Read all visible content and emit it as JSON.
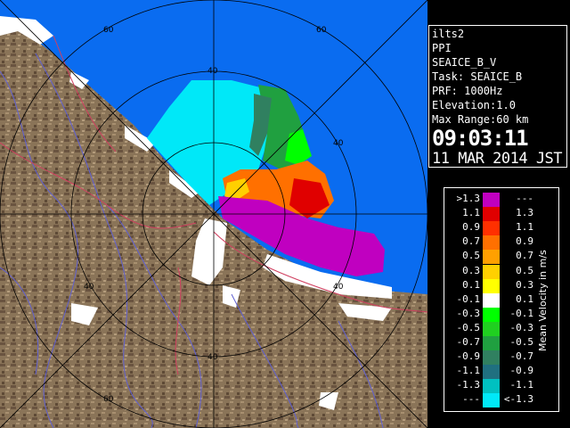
{
  "info": {
    "lines": [
      "ilts2",
      "PPI",
      "SEAICE_B_V",
      "Task: SEAICE_B",
      "PRF: 1000Hz",
      "Elevation:1.0",
      "Max Range:60 km"
    ],
    "time": "09:03:11",
    "date": "11 MAR 2014 JST"
  },
  "legend": {
    "units": "Mean Velocity in m/s",
    "rows": [
      {
        "left": ">1.3",
        "right": "---",
        "color": "#c000c0"
      },
      {
        "left": "1.1",
        "right": "1.3",
        "color": "#e00000"
      },
      {
        "left": "0.9",
        "right": "1.1",
        "color": "#ff3000"
      },
      {
        "left": "0.7",
        "right": "0.9",
        "color": "#ff7000"
      },
      {
        "left": "0.5",
        "right": "0.7",
        "color": "#ffa000"
      },
      {
        "left": "0.3",
        "right": "0.5",
        "color": "#ffd000"
      },
      {
        "left": "0.1",
        "right": "0.3",
        "color": "#ffff00"
      },
      {
        "left": "-0.1",
        "right": "0.1",
        "color": "#ffffff"
      },
      {
        "left": "-0.3",
        "right": "-0.1",
        "color": "#00ff00"
      },
      {
        "left": "-0.5",
        "right": "-0.3",
        "color": "#20d020"
      },
      {
        "left": "-0.7",
        "right": "-0.5",
        "color": "#20a040"
      },
      {
        "left": "-0.9",
        "right": "-0.7",
        "color": "#308060"
      },
      {
        "left": "-1.1",
        "right": "-0.9",
        "color": "#207080"
      },
      {
        "left": "-1.3",
        "right": "-1.1",
        "color": "#00c0c0"
      },
      {
        "left": "---",
        "right": "<-1.3",
        "color": "#00e8f8"
      }
    ]
  },
  "map": {
    "ring_labels": [
      "40",
      "60"
    ],
    "colors": {
      "sea": "#0a6cf0",
      "land": "#8a7458",
      "snow": "#ffffff",
      "river": "#6060d0",
      "road": "#d04060",
      "grid": "#000000"
    }
  }
}
